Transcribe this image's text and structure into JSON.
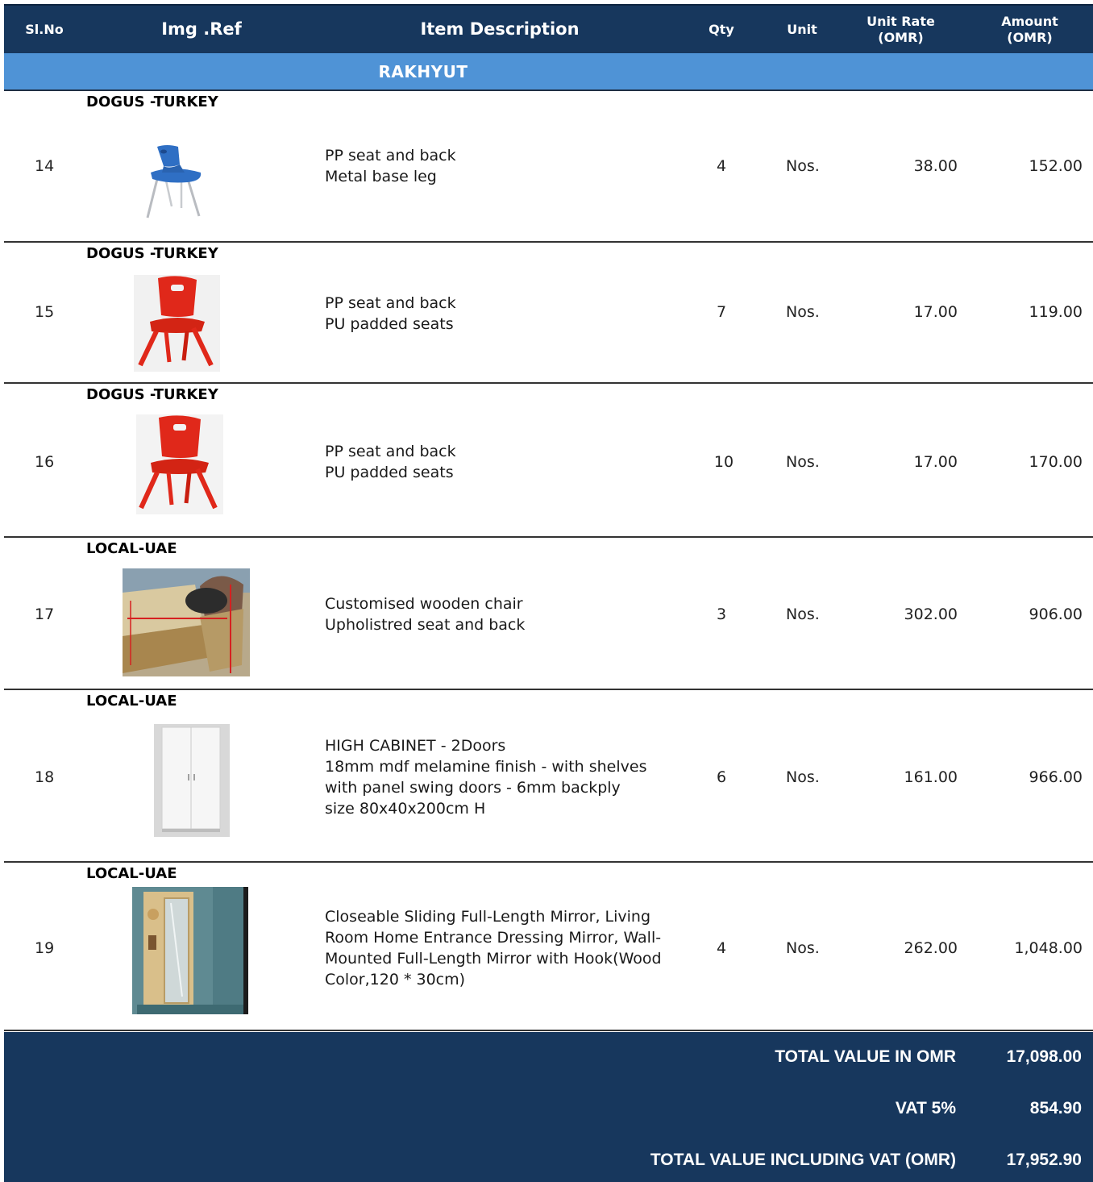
{
  "columns": {
    "slno": "Sl.No",
    "img": "Img .Ref",
    "desc": "Item Description",
    "qty": "Qty",
    "unit": "Unit",
    "rate_line1": "Unit Rate",
    "rate_line2": "(OMR)",
    "amount_line1": "Amount",
    "amount_line2": "(OMR)"
  },
  "section": "RAKHYUT",
  "items": [
    {
      "slno": "14",
      "brand": "DOGUS -TURKEY",
      "desc1": "PP seat and back",
      "desc2": "Metal base leg",
      "qty": "4",
      "unit": "Nos.",
      "rate": "38.00",
      "amount": "152.00"
    },
    {
      "slno": "15",
      "brand": "DOGUS -TURKEY",
      "desc1": "PP seat and back",
      "desc2": "PU padded seats",
      "qty": "7",
      "unit": "Nos.",
      "rate": "17.00",
      "amount": "119.00"
    },
    {
      "slno": "16",
      "brand": "DOGUS -TURKEY",
      "desc1": "PP seat and back",
      "desc2": "PU padded seats",
      "qty": "10",
      "unit": "Nos.",
      "rate": "17.00",
      "amount": "170.00"
    },
    {
      "slno": "17",
      "brand": "LOCAL-UAE",
      "desc1": "Customised wooden chair",
      "desc2": "Upholistred seat and back",
      "qty": "3",
      "unit": "Nos.",
      "rate": "302.00",
      "amount": "906.00"
    },
    {
      "slno": "18",
      "brand": "LOCAL-UAE",
      "desc1": "HIGH CABINET - 2Doors",
      "desc2": "18mm mdf melamine finish - with shelves",
      "desc3": "with panel swing doors - 6mm backply",
      "desc4": "size 80x40x200cm H",
      "qty": "6",
      "unit": "Nos.",
      "rate": "161.00",
      "amount": "966.00"
    },
    {
      "slno": "19",
      "brand": "LOCAL-UAE",
      "desc1": "Closeable Sliding Full-Length Mirror, Living",
      "desc2": "Room Home Entrance Dressing Mirror, Wall-",
      "desc3": "Mounted Full-Length Mirror with Hook(Wood",
      "desc4": "Color,120 * 30cm)",
      "qty": "4",
      "unit": "Nos.",
      "rate": "262.00",
      "amount": "1,048.00"
    }
  ],
  "totals": {
    "total_label": "TOTAL VALUE IN OMR",
    "total_value": "17,098.00",
    "vat_label": "VAT 5%",
    "vat_value": "854.90",
    "grand_label": "TOTAL VALUE INCLUDING VAT (OMR)",
    "grand_value": "17,952.90"
  },
  "colors": {
    "header_bg": "#17375d",
    "section_bg": "#4f93d6",
    "chair_blue": "#2f6fc4",
    "chair_red": "#e0281a"
  }
}
